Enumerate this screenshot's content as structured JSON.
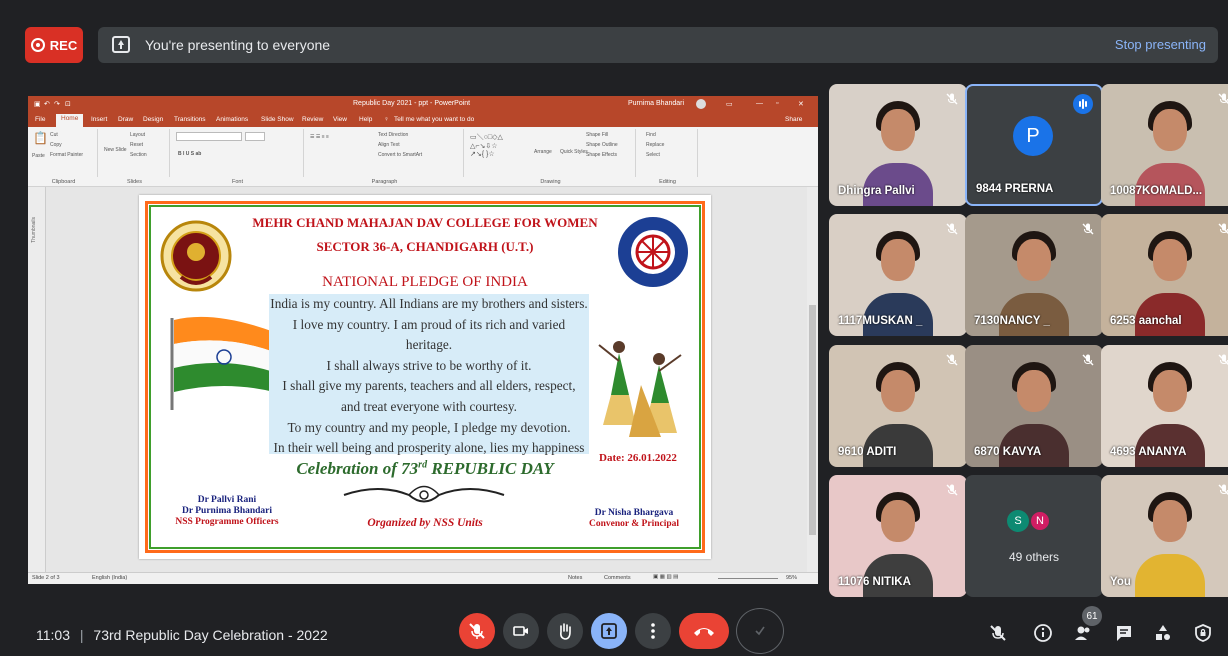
{
  "topbar": {
    "rec_label": "REC",
    "presenting_text": "You're presenting to everyone",
    "stop_label": "Stop presenting"
  },
  "ppt": {
    "title": "Republic Day 2021 - ppt  -  PowerPoint",
    "user": "Purnima Bhandari",
    "tabs": [
      "File",
      "Home",
      "Insert",
      "Draw",
      "Design",
      "Transitions",
      "Animations",
      "Slide Show",
      "Review",
      "View",
      "Help",
      "Tell me what you want to do",
      "Share"
    ],
    "groups": [
      "Clipboard",
      "Slides",
      "Font",
      "Paragraph",
      "Drawing",
      "Editing"
    ],
    "ribbon_items": {
      "paste": "Paste",
      "cut": "Cut",
      "copy": "Copy",
      "format_painter": "Format Painter",
      "new_slide": "New Slide",
      "layout": "Layout",
      "reset": "Reset",
      "section": "Section",
      "text_direction": "Text Direction",
      "align_text": "Align Text",
      "smartart": "Convert to SmartArt",
      "arrange": "Arrange",
      "quick_styles": "Quick Styles",
      "shape_fill": "Shape Fill",
      "shape_outline": "Shape Outline",
      "shape_effects": "Shape Effects",
      "find": "Find",
      "replace": "Replace",
      "select": "Select"
    },
    "thumbnails_label": "Thumbnails",
    "status_left": "Slide 2 of 3",
    "status_lang": "English (India)",
    "status_notes": "Notes",
    "status_comments": "Comments",
    "zoom": "95%"
  },
  "slide": {
    "college_line1": "MEHR CHAND MAHAJAN DAV COLLEGE FOR WOMEN",
    "college_line2": "SECTOR 36-A, CHANDIGARH (U.T.)",
    "pledge_title": "NATIONAL PLEDGE OF INDIA",
    "pledge_lines": [
      "India is my country. All Indians are my brothers and sisters.",
      "I love my country. I am proud of its rich and varied heritage.",
      "I shall always strive to be worthy of it.",
      "I shall give my parents, teachers and all elders, respect,",
      "and treat everyone with courtesy.",
      "To my country and my people, I pledge my devotion.",
      "In their well being and prosperity alone, lies my happiness"
    ],
    "celebration_pre": "Celebration of 73",
    "celebration_sup": "rd",
    "celebration_post": " REPUBLIC DAY",
    "date": "Date: 26.01.2022",
    "sig_left": [
      "Dr Pallvi Rani",
      "Dr Purnima Bhandari",
      "NSS Programme Officers"
    ],
    "organized": "Organized by NSS Units",
    "sig_right": [
      "Dr Nisha Bhargava",
      "Convenor & Principal"
    ]
  },
  "participants": [
    {
      "name": "Dhingra Pallvi"
    },
    {
      "name": "9844 PRERNA",
      "initial": "P"
    },
    {
      "name": "10087KOMALD..."
    },
    {
      "name": "1117MUSKAN _"
    },
    {
      "name": "7130NANCY _"
    },
    {
      "name": "6253 aanchal"
    },
    {
      "name": "9610 ADITI"
    },
    {
      "name": "6870 KAVYA"
    },
    {
      "name": "4693 ANANYA"
    },
    {
      "name": "11076 NITIKA"
    },
    {
      "name": "You"
    }
  ],
  "others": {
    "label": "49 others",
    "initials": [
      "S",
      "N"
    ]
  },
  "bottombar": {
    "time": "11:03",
    "separator": "|",
    "meeting_title": "73rd Republic Day Celebration - 2022",
    "people_count": "61"
  },
  "colors": {
    "rec": "#d93025",
    "end_call": "#ea4335",
    "accent": "#8ab4f8",
    "present": "#8ab4f8",
    "ppt": "#b7472a"
  }
}
